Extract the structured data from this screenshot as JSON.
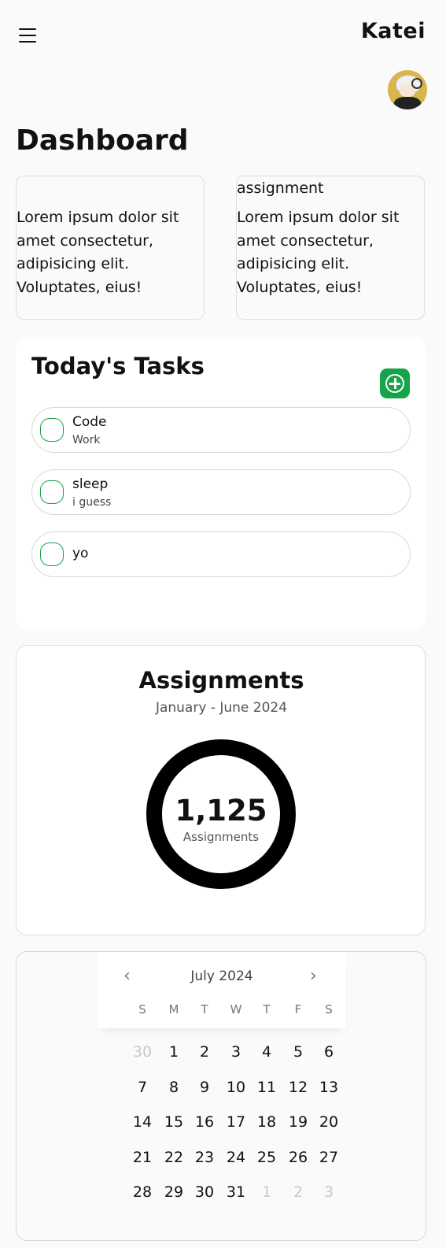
{
  "header": {
    "brand": "Katei",
    "menu_icon": "hamburger-menu-icon",
    "avatar": "user-avatar"
  },
  "page": {
    "title": "Dashboard"
  },
  "info_cards": [
    {
      "title": "",
      "body": "Lorem ipsum dolor sit amet consectetur, adipisicing elit. Voluptates, eius!"
    },
    {
      "title": "assignment",
      "body": "Lorem ipsum dolor sit amet consectetur, adipisicing elit. Voluptates, eius!"
    }
  ],
  "tasks": {
    "title": "Today's Tasks",
    "add_icon": "plus-circle-icon",
    "accent_color": "#16a34a",
    "items": [
      {
        "name": "Code",
        "subtitle": "Work",
        "done": false
      },
      {
        "name": "sleep",
        "subtitle": "i guess",
        "done": false
      },
      {
        "name": "yo",
        "subtitle": "",
        "done": false
      }
    ]
  },
  "assignments": {
    "title": "Assignments",
    "range": "January - June 2024",
    "total": "1,125",
    "total_label": "Assignments",
    "ring_color": "#000000"
  },
  "calendar": {
    "month": "July 2024",
    "prev_icon": "chevron-left-icon",
    "next_icon": "chevron-right-icon",
    "weekdays": [
      "S",
      "M",
      "T",
      "W",
      "T",
      "F",
      "S"
    ],
    "weeks": [
      [
        {
          "d": "30",
          "muted": true
        },
        {
          "d": "1"
        },
        {
          "d": "2"
        },
        {
          "d": "3"
        },
        {
          "d": "4"
        },
        {
          "d": "5"
        },
        {
          "d": "6"
        }
      ],
      [
        {
          "d": "7"
        },
        {
          "d": "8"
        },
        {
          "d": "9"
        },
        {
          "d": "10"
        },
        {
          "d": "11"
        },
        {
          "d": "12"
        },
        {
          "d": "13"
        }
      ],
      [
        {
          "d": "14"
        },
        {
          "d": "15"
        },
        {
          "d": "16"
        },
        {
          "d": "17"
        },
        {
          "d": "18"
        },
        {
          "d": "19"
        },
        {
          "d": "20"
        }
      ],
      [
        {
          "d": "21"
        },
        {
          "d": "22"
        },
        {
          "d": "23"
        },
        {
          "d": "24"
        },
        {
          "d": "25"
        },
        {
          "d": "26"
        },
        {
          "d": "27"
        }
      ],
      [
        {
          "d": "28"
        },
        {
          "d": "29"
        },
        {
          "d": "30"
        },
        {
          "d": "31"
        },
        {
          "d": "1",
          "muted": true
        },
        {
          "d": "2",
          "muted": true
        },
        {
          "d": "3",
          "muted": true
        }
      ]
    ]
  }
}
